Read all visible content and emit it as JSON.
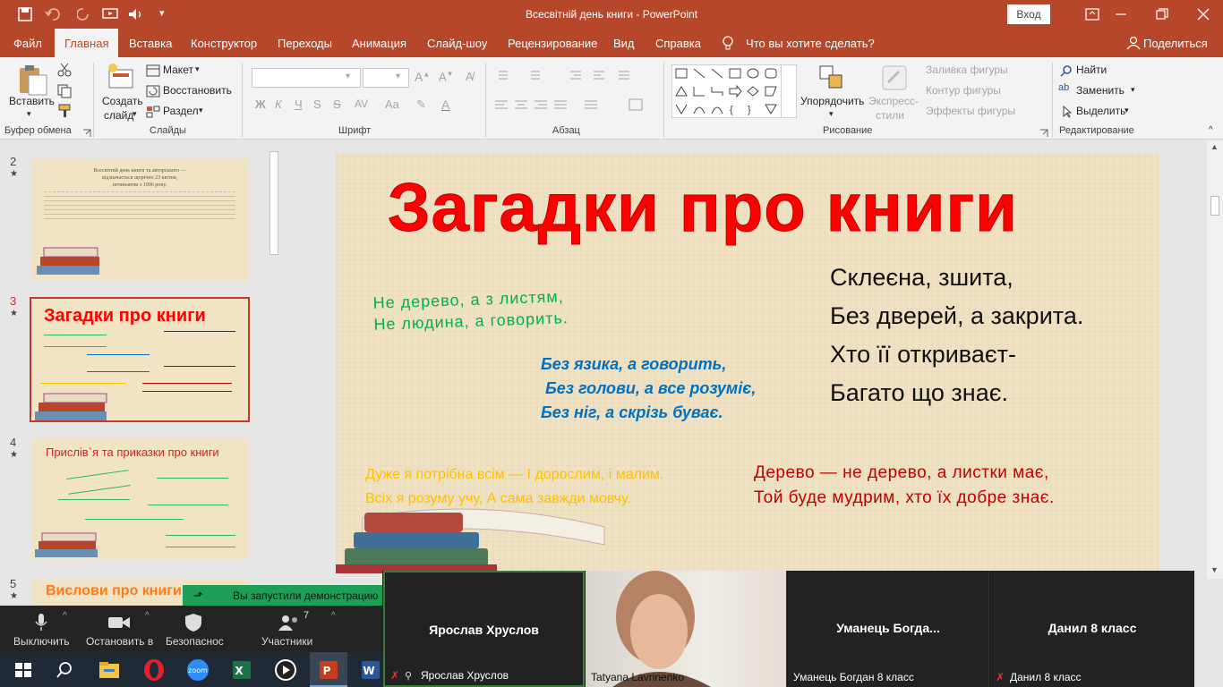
{
  "titlebar": {
    "title": "Всесвітній день книги  -  PowerPoint",
    "signin": "Вход"
  },
  "tabs": [
    {
      "label": "Файл"
    },
    {
      "label": "Главная"
    },
    {
      "label": "Вставка"
    },
    {
      "label": "Конструктор"
    },
    {
      "label": "Переходы"
    },
    {
      "label": "Анимация"
    },
    {
      "label": "Слайд-шоу"
    },
    {
      "label": "Рецензирование"
    },
    {
      "label": "Вид"
    },
    {
      "label": "Справка"
    },
    {
      "label": "Что вы хотите сделать?"
    }
  ],
  "share_label": "Поделиться",
  "ribbon": {
    "clipboard": {
      "group": "Буфер обмена",
      "paste": "Вставить"
    },
    "slides": {
      "group": "Слайды",
      "new_slide_1": "Создать",
      "new_slide_2": "слайд",
      "layout": "Макет",
      "reset": "Восстановить",
      "section": "Раздел"
    },
    "font": {
      "group": "Шрифт",
      "bold": "Ж",
      "italic": "К",
      "underline": "Ч",
      "strike": "S"
    },
    "paragraph": {
      "group": "Абзац"
    },
    "drawing": {
      "group": "Рисование",
      "arrange": "Упорядочить",
      "styles_1": "Экспресс-",
      "styles_2": "стили",
      "fill": "Заливка фигуры",
      "outline": "Контур фигуры",
      "effects": "Эффекты фигуры"
    },
    "editing": {
      "group": "Редактирование",
      "find": "Найти",
      "replace": "Заменить",
      "select": "Выделить"
    }
  },
  "thumbnails": [
    {
      "num": "2",
      "star": "★",
      "title": "Всесвітній день книги та авторського —",
      "t2": "відзначається щорічно 23 квітня,",
      "t3": "починаючи з 1996 року."
    },
    {
      "num": "3",
      "star": "★",
      "title": "Загадки про книги",
      "selected": true
    },
    {
      "num": "4",
      "star": "★",
      "title": "Прислів`я  та приказки про книги"
    },
    {
      "num": "5",
      "star": "★",
      "title": "Вислови про книги"
    }
  ],
  "slide": {
    "title": "Загадки про книги",
    "riddle_green": [
      "Не дерево, а з листям,",
      "Не людина, а говорить."
    ],
    "riddle_blue": [
      "Без язика, а говорить,",
      "Без голови, а все розуміє,",
      "Без ніг, а скрізь буває."
    ],
    "riddle_black": [
      "Склеєна, зшита,",
      "Без дверей, а закрита.",
      "Хто її откриваєт-",
      "Багато що знає."
    ],
    "riddle_orange": [
      "Дуже я потрібна всім — І дорослим, і малим.",
      "Всіх я розуму учу, А сама завжди мовчу."
    ],
    "riddle_red": [
      "Дерево — не дерево, а листки має,",
      "Той буде мудрим, хто їх добре знає."
    ],
    "colors": {
      "title": "#ff0000",
      "green": "#00b050",
      "blue": "#0070c0",
      "orange": "#ffc000",
      "red": "#c00000"
    }
  },
  "zoom": {
    "toast": "Вы запустили демонстрацию",
    "mute": "Выключить",
    "video": "Остановить в",
    "security": "Безопаснос",
    "participants": "Участники",
    "participants_count": "7"
  },
  "participants": [
    {
      "big": "Ярослав Хруслов",
      "small": "Ярослав Хруслов"
    },
    {
      "big": "",
      "small": "Tatyana Lavrinenko"
    },
    {
      "big": "Уманець  Богда...",
      "small": "Уманець Богдан 8 класс"
    },
    {
      "big": "Данил 8 класс",
      "small": "Данил 8 класс"
    }
  ]
}
